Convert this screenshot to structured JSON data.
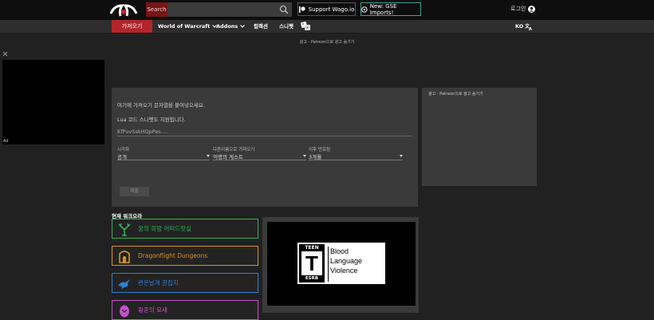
{
  "header": {
    "search_label": "Search",
    "support_label": "Support Wago.io",
    "gse_label": "New: GSE Imports!",
    "login_label": "로그인"
  },
  "nav": {
    "import_label": "가져오기",
    "items": [
      "World of Warcraft",
      "Addons",
      "컬렉션",
      "스니펫"
    ],
    "lang_label": "KO"
  },
  "ads": {
    "top_label": "광고 - Patreon으로 광고 숨기기",
    "side_label": "광고 - Patreon으로 광고 숨기기",
    "ad_tag": "Ad"
  },
  "import_panel": {
    "hint1": "여기에 가져오기 문자열을 붙여넣으세요.",
    "hint2": "Lua 코드 스니펫도 지원됩니다.",
    "input_value": "KfPuv5skHQpPes....",
    "visibility_label": "시각화",
    "visibility_value": "공개",
    "import_as_label": "다른이름으로 가져오기",
    "import_as_value": "익명의 게스트",
    "expire_label": "이후 만료됨",
    "expire_value": "3개월",
    "submit_label": "제출"
  },
  "categories": {
    "title": "현재 워크오라",
    "items": [
      {
        "label": "꿈의 희망 어미드랏실",
        "color": "#2fae5a"
      },
      {
        "label": "Dragonflight Dungeons",
        "color": "#d8941c"
      },
      {
        "label": "련은날개 광칩지",
        "color": "#2f7fd0"
      },
      {
        "label": "황혼의 묘새",
        "color": "#c64fc9"
      }
    ]
  },
  "esrb": {
    "rating": "TEEN",
    "letter": "T",
    "brand": "ESRB",
    "descriptors": [
      "Blood",
      "Language",
      "Violence"
    ]
  },
  "colors": {
    "accent_red": "#b3252b",
    "gse_border": "#3aa58f"
  }
}
